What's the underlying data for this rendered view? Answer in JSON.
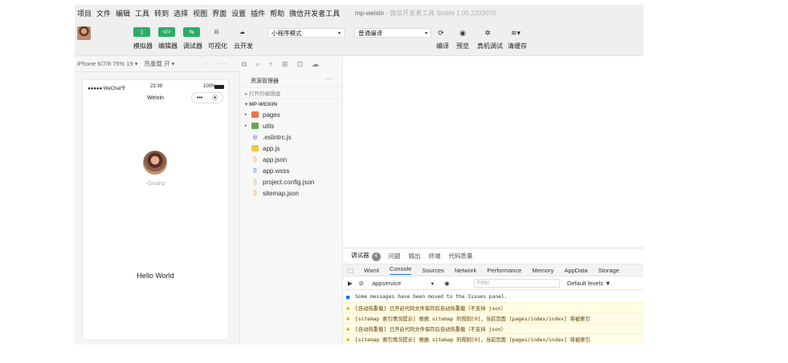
{
  "menu": {
    "items": [
      "项目",
      "文件",
      "编辑",
      "工具",
      "转到",
      "选择",
      "视图",
      "界面",
      "设置",
      "插件",
      "帮助",
      "微信开发者工具"
    ],
    "title": "mp-weixin",
    "subtitle": " - 微信开发者工具 Stable 1.05.2203070"
  },
  "toolbar": {
    "simulator_label": "模拟器",
    "editor_label": "编辑器",
    "debugger_label": "调试器",
    "visual_label": "可视化",
    "cloud_label": "云开发",
    "mode_select": "小程序模式",
    "compile_select": "普通编译",
    "compile_label": "编译",
    "preview_label": "预览",
    "remote_debug_label": "真机调试",
    "clear_cache_label": "清缓存",
    "accent_color": "#2aae67"
  },
  "devicebar": {
    "device": "iPhone 6/7/8 75% 19 ▾",
    "hot_reload": "热重载 开 ▾"
  },
  "phone": {
    "carrier": "●●●●● WeChat令",
    "time": "23:39",
    "battery": "100%",
    "nav_title": "Weixin",
    "capsule_more": "•••",
    "capsule_close": "⦿",
    "nickname": "-Gnahz",
    "hello": "Hello World"
  },
  "files": {
    "panel_title": "资源管理器",
    "more": "···",
    "open_editors": "▸ 打开的编辑器",
    "project": "▾ MP-WEIXIN",
    "tree": [
      {
        "name": "pages",
        "type": "folder-orange",
        "caret": "▸"
      },
      {
        "name": "utils",
        "type": "folder-green",
        "caret": "▸"
      },
      {
        "name": ".eslintrc.js",
        "type": "eslint",
        "caret": ""
      },
      {
        "name": "app.js",
        "type": "js",
        "caret": ""
      },
      {
        "name": "app.json",
        "type": "json",
        "caret": ""
      },
      {
        "name": "app.wxss",
        "type": "wxss",
        "caret": ""
      },
      {
        "name": "project.config.json",
        "type": "json",
        "caret": ""
      },
      {
        "name": "sitemap.json",
        "type": "json",
        "caret": ""
      }
    ]
  },
  "console": {
    "top_tabs": [
      "调试器",
      "问题",
      "输出",
      "终端",
      "代码质量"
    ],
    "debugger_badge": "4",
    "tabs": [
      "Wxml",
      "Console",
      "Sources",
      "Network",
      "Performance",
      "Memory",
      "AppData",
      "Storage"
    ],
    "context": "appservice",
    "filter_placeholder": "Filter",
    "levels": "Default levels ▼",
    "messages": [
      {
        "level": "info",
        "text": "Some messages have been moved to the Issues panel."
      },
      {
        "level": "warn",
        "text": "[自动热重载] 已开启代码文件保存后自动热重载（不支持 json）"
      },
      {
        "level": "warn",
        "text": "[sitemap 索引情况提示] 根据 sitemap 的规则[0]，当前页面 [pages/index/index] 将被索引"
      },
      {
        "level": "warn",
        "text": "[自动热重载] 已开启代码文件保存后自动热重载（不支持 json）"
      },
      {
        "level": "warn",
        "text": "[sitemap 索引情况提示] 根据 sitemap 的规则[0]，当前页面 [pages/index/index] 将被索引"
      }
    ]
  }
}
